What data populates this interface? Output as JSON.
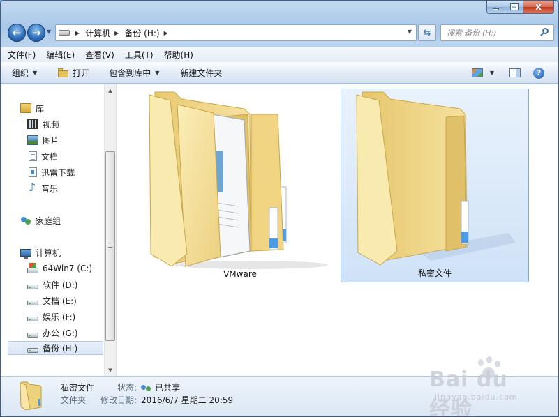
{
  "window": {
    "caption_min": "",
    "caption_max": "",
    "caption_close": "x"
  },
  "address": {
    "crumbs": [
      "计算机",
      "备份 (H:)"
    ]
  },
  "search": {
    "placeholder": "搜索 备份 (H:)"
  },
  "menu": [
    "文件(F)",
    "编辑(E)",
    "查看(V)",
    "工具(T)",
    "帮助(H)"
  ],
  "commands": {
    "organize": "组织",
    "open": "打开",
    "include_library": "包含到库中",
    "new_folder": "新建文件夹"
  },
  "nav": {
    "libraries": "库",
    "library_items": [
      "视频",
      "图片",
      "文档",
      "迅雷下载",
      "音乐"
    ],
    "homegroup": "家庭组",
    "computer": "计算机",
    "drives": [
      "64Win7 (C:)",
      "软件 (D:)",
      "文档 (E:)",
      "娱乐 (F:)",
      "办公 (G:)",
      "备份 (H:)"
    ],
    "selected_drive": "备份 (H:)"
  },
  "folders": [
    {
      "name": "VMware",
      "selected": false
    },
    {
      "name": "私密文件",
      "selected": true
    }
  ],
  "details": {
    "name": "私密文件",
    "type": "文件夹",
    "state_label": "状态:",
    "state_value": "已共享",
    "modified_label": "修改日期:",
    "modified_value": "2016/6/7 星期二 20:59"
  },
  "watermark": {
    "main": "Bai du 经验",
    "sub": "jingyan.baidu.com"
  },
  "colors": {
    "selection": "#cfe2f7",
    "selection_border": "#84acdd",
    "folder": "#f2d888"
  }
}
